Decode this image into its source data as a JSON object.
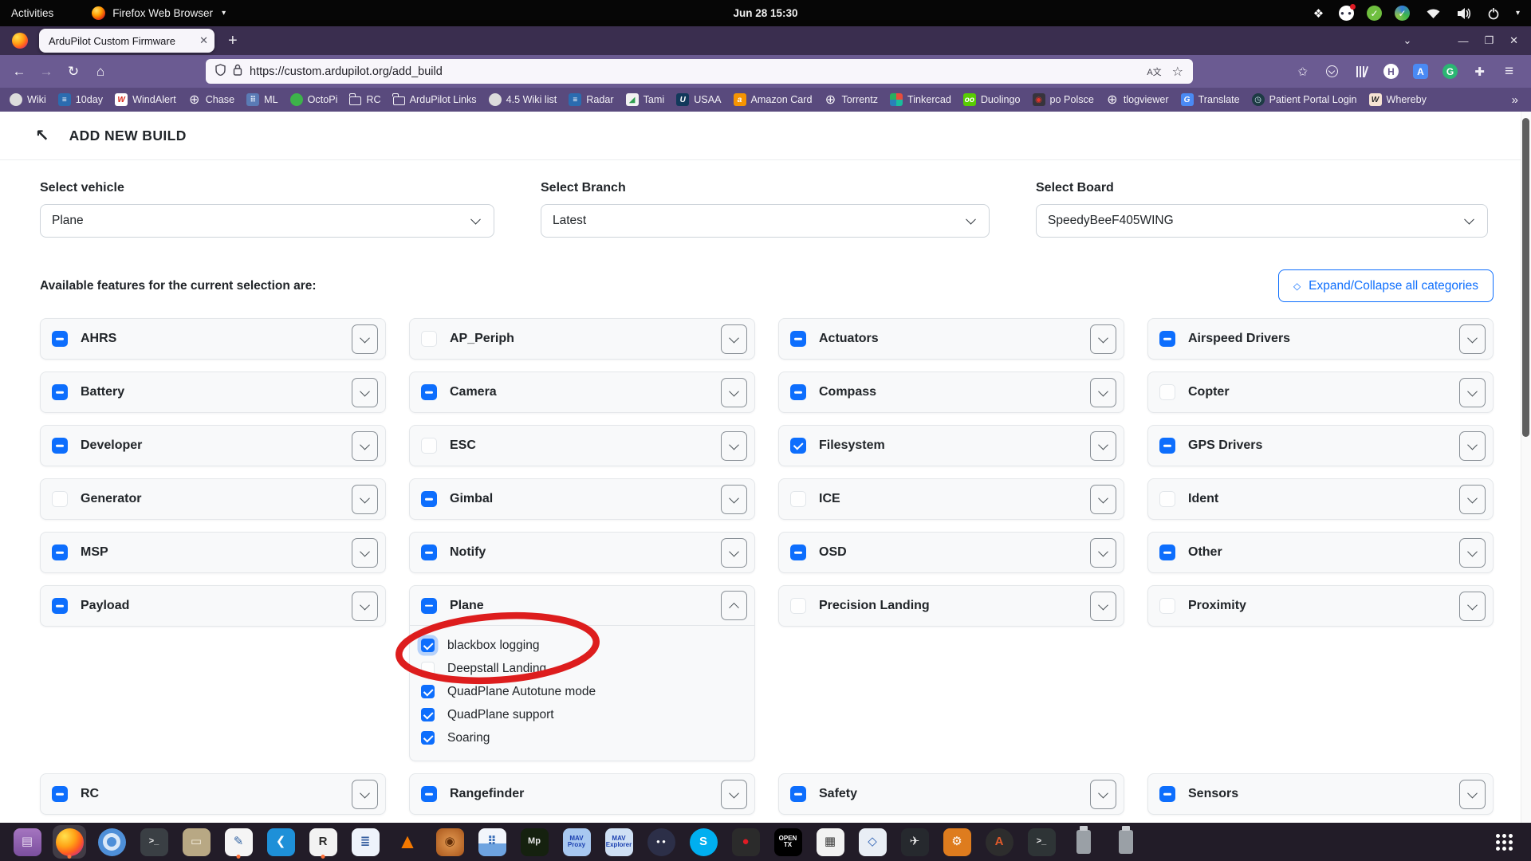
{
  "system_bar": {
    "activities_label": "Activities",
    "app_menu_label": "Firefox Web Browser",
    "app_menu_caret": "▾",
    "clock": "Jun 28 15:30",
    "tray": [
      {
        "name": "dropbox-icon",
        "glyph": "❖",
        "bg": "transparent",
        "fg": "#ffffff"
      },
      {
        "name": "discord-icon",
        "glyph": "● ●",
        "bg": "#ffffff",
        "fg": "#2b2d42",
        "notification": true
      },
      {
        "name": "todo-check-icon",
        "glyph": "✓",
        "bg": "#6fbf3f",
        "fg": "#ffffff"
      },
      {
        "name": "sync-check-icon",
        "glyph": "✓",
        "bg": "",
        "fg": "#ffffff"
      }
    ]
  },
  "browser": {
    "tab_title": "ArduPilot Custom Firmware",
    "tab_close_glyph": "✕",
    "new_tab_glyph": "+",
    "window_controls": [
      {
        "name": "list-tabs-chevron",
        "glyph": "⌄"
      },
      {
        "name": "minimize-button",
        "glyph": "—"
      },
      {
        "name": "restore-button",
        "glyph": "❐"
      },
      {
        "name": "close-button",
        "glyph": "✕"
      }
    ],
    "nav": {
      "back": "←",
      "forward": "→",
      "reload": "↻",
      "home": "⌂"
    },
    "url": "https://custom.ardupilot.org/add_build",
    "url_translate_glyph": "A文",
    "url_star_glyph": "☆",
    "toolbar_icons": [
      {
        "name": "account-star-icon",
        "glyph": "✩"
      },
      {
        "name": "pocket-icon",
        "glyph": ""
      },
      {
        "name": "library-icon",
        "glyph": ""
      },
      {
        "name": "h-extension-icon",
        "glyph": "H"
      },
      {
        "name": "translate-extension-icon",
        "glyph": "A"
      },
      {
        "name": "grammarly-icon",
        "glyph": "G"
      },
      {
        "name": "extensions-puzzle-icon",
        "glyph": "✚"
      },
      {
        "name": "menu-icon",
        "glyph": "≡"
      }
    ],
    "bookmarks": [
      {
        "label": "Wiki",
        "icon": "github-icon",
        "shape": "circle",
        "bg": "#dcdcdc",
        "fg": "#24292e",
        "glyph": ""
      },
      {
        "label": "10day",
        "icon": "weather-channel-icon",
        "shape": "",
        "bg": "#2b6cb0",
        "fg": "#fff",
        "glyph": "≡"
      },
      {
        "label": "WindAlert",
        "icon": "windalert-icon",
        "shape": "",
        "bg": "#fff",
        "fg": "#d6281a",
        "glyph": "W"
      },
      {
        "label": "Chase",
        "icon": "globe-icon",
        "shape": "globe",
        "bg": "",
        "fg": "#f4f2f7",
        "glyph": "⊕"
      },
      {
        "label": "ML",
        "icon": "ml-icon",
        "shape": "",
        "bg": "#5a7bb5",
        "fg": "#dce6f5",
        "glyph": "⠿"
      },
      {
        "label": "OctoPi",
        "icon": "octopi-icon",
        "shape": "circle",
        "bg": "#3db34a",
        "fg": "#fff",
        "glyph": ""
      },
      {
        "label": "RC",
        "icon": "folder-icon",
        "shape": "folder",
        "bg": "",
        "fg": "",
        "glyph": ""
      },
      {
        "label": "ArduPilot Links",
        "icon": "folder-icon",
        "shape": "folder",
        "bg": "",
        "fg": "",
        "glyph": ""
      },
      {
        "label": "4.5 Wiki list",
        "icon": "github-icon",
        "shape": "circle",
        "bg": "#dcdcdc",
        "fg": "#24292e",
        "glyph": ""
      },
      {
        "label": "Radar",
        "icon": "weather-channel-icon",
        "shape": "",
        "bg": "#2b6cb0",
        "fg": "#fff",
        "glyph": "≡"
      },
      {
        "label": "Tami",
        "icon": "chart-icon",
        "shape": "",
        "bg": "#f2f2f2",
        "fg": "#2e9e4f",
        "glyph": "◢"
      },
      {
        "label": "USAA",
        "icon": "usaa-icon",
        "shape": "",
        "bg": "#12395b",
        "fg": "#fff",
        "glyph": "U"
      },
      {
        "label": "Amazon  Card",
        "icon": "amazon-icon",
        "shape": "",
        "bg": "#f59402",
        "fg": "#fff",
        "glyph": "a"
      },
      {
        "label": "Torrentz",
        "icon": "globe-icon",
        "shape": "globe",
        "bg": "",
        "fg": "#f4f2f7",
        "glyph": "⊕"
      },
      {
        "label": "Tinkercad",
        "icon": "tinkercad-icon",
        "shape": "",
        "bg": "conic-gradient(#e74c3c 0 25%, #1abc9c 0 50%, #2980b9 0 75%, #27ae60 0)",
        "fg": "#fff",
        "glyph": ""
      },
      {
        "label": "Duolingo",
        "icon": "duolingo-icon",
        "shape": "",
        "bg": "#58cc02",
        "fg": "#fff",
        "glyph": "oo"
      },
      {
        "label": "po Polsce",
        "icon": "map-pin-icon",
        "shape": "",
        "bg": "#37343d",
        "fg": "#e0342b",
        "glyph": "◉"
      },
      {
        "label": "tlogviewer",
        "icon": "globe-icon",
        "shape": "globe",
        "bg": "",
        "fg": "#f4f2f7",
        "glyph": "⊕"
      },
      {
        "label": "Translate",
        "icon": "translate-icon",
        "shape": "",
        "bg": "#4a8af4",
        "fg": "#fff",
        "glyph": "G"
      },
      {
        "label": "Patient Portal Login",
        "icon": "portal-clock-icon",
        "shape": "circle",
        "bg": "#1d3b44",
        "fg": "#cfe7ee",
        "glyph": "◷"
      },
      {
        "label": "Whereby",
        "icon": "whereby-icon",
        "shape": "",
        "bg": "#f6e3d3",
        "fg": "#2b2b2b",
        "glyph": "W"
      }
    ],
    "bookmarks_overflow_glyph": "»"
  },
  "page": {
    "header_title": "ADD NEW BUILD",
    "back_arrow_glyph": "↖",
    "selectors": [
      {
        "label": "Select vehicle",
        "value": "Plane"
      },
      {
        "label": "Select Branch",
        "value": "Latest"
      },
      {
        "label": "Select Board",
        "value": "SpeedyBeeF405WING"
      }
    ],
    "features_heading": "Available features for the current selection are:",
    "expand_button_label": "Expand/Collapse all categories",
    "expand_button_glyph": "◇",
    "categories": [
      {
        "name": "AHRS",
        "state": "indeterminate"
      },
      {
        "name": "AP_Periph",
        "state": "unchecked"
      },
      {
        "name": "Actuators",
        "state": "indeterminate"
      },
      {
        "name": "Airspeed Drivers",
        "state": "indeterminate"
      },
      {
        "name": "Battery",
        "state": "indeterminate"
      },
      {
        "name": "Camera",
        "state": "indeterminate"
      },
      {
        "name": "Compass",
        "state": "indeterminate"
      },
      {
        "name": "Copter",
        "state": "unchecked"
      },
      {
        "name": "Developer",
        "state": "indeterminate"
      },
      {
        "name": "ESC",
        "state": "unchecked"
      },
      {
        "name": "Filesystem",
        "state": "checked"
      },
      {
        "name": "GPS Drivers",
        "state": "indeterminate"
      },
      {
        "name": "Generator",
        "state": "unchecked"
      },
      {
        "name": "Gimbal",
        "state": "indeterminate"
      },
      {
        "name": "ICE",
        "state": "unchecked"
      },
      {
        "name": "Ident",
        "state": "unchecked"
      },
      {
        "name": "MSP",
        "state": "indeterminate"
      },
      {
        "name": "Notify",
        "state": "indeterminate"
      },
      {
        "name": "OSD",
        "state": "indeterminate"
      },
      {
        "name": "Other",
        "state": "indeterminate"
      },
      {
        "name": "Payload",
        "state": "indeterminate"
      },
      {
        "name": "Plane",
        "state": "indeterminate",
        "expanded": true,
        "children": [
          {
            "label": "blackbox logging",
            "state": "checked",
            "focused": true
          },
          {
            "label": "Deepstall Landing",
            "state": "unchecked"
          },
          {
            "label": "QuadPlane Autotune mode",
            "state": "checked"
          },
          {
            "label": "QuadPlane support",
            "state": "checked"
          },
          {
            "label": "Soaring",
            "state": "checked"
          }
        ]
      },
      {
        "name": "Precision Landing",
        "state": "unchecked"
      },
      {
        "name": "Proximity",
        "state": "unchecked"
      },
      {
        "name": "RC",
        "state": "indeterminate"
      },
      {
        "name": "Rangefinder",
        "state": "indeterminate"
      },
      {
        "name": "Safety",
        "state": "indeterminate"
      },
      {
        "name": "Sensors",
        "state": "indeterminate"
      }
    ],
    "annotation": {
      "type": "red-ellipse",
      "target": "blackbox logging",
      "color": "#dd1d1d"
    }
  },
  "dock": {
    "items": [
      {
        "app": "purple-files",
        "icon": "purple-app-icon",
        "bg": "linear-gradient(180deg,#a575c0,#7b4f9e)",
        "fg": "#e7d9f0",
        "glyph": "▤"
      },
      {
        "app": "firefox",
        "icon": "firefox-icon",
        "shape": "firefox-shape",
        "glyph": "",
        "active": true,
        "running": true
      },
      {
        "app": "chromium",
        "icon": "chromium-icon",
        "shape": "circle ring",
        "bg": "#4e8fd8",
        "glyph": ""
      },
      {
        "app": "terminal",
        "icon": "terminal-icon",
        "bg": "#3a3f44",
        "fg": "#e6e6e6",
        "glyph": ">_",
        "size": "mid"
      },
      {
        "app": "files",
        "icon": "folder-icon",
        "bg": "#b8a884",
        "fg": "#f4eedd",
        "glyph": "▭"
      },
      {
        "app": "text-editor",
        "icon": "text-editor-icon",
        "bg": "#f5f5f5",
        "fg": "#3465a4",
        "glyph": "✎",
        "running": true
      },
      {
        "app": "vscode",
        "icon": "vscode-icon",
        "bg": "#1e90d8",
        "fg": "#fff",
        "glyph": "❮"
      },
      {
        "app": "r-notepad",
        "icon": "r-app-icon",
        "bg": "#f2f2f2",
        "fg": "#2b2b2b",
        "glyph": "R",
        "running": true
      },
      {
        "app": "libreoffice-writer",
        "icon": "writer-icon",
        "bg": "#eef3fb",
        "fg": "#355fa0",
        "glyph": "≣"
      },
      {
        "app": "vlc",
        "icon": "vlc-cone-icon",
        "shape": "cone",
        "fg": "#f57900",
        "glyph": "▲"
      },
      {
        "app": "spiral-app",
        "icon": "spiral-app-icon",
        "bg": "radial-gradient(circle,#e39a52,#a9561b)",
        "fg": "#5f2c08",
        "glyph": "◉"
      },
      {
        "app": "snap-store",
        "icon": "app-store-bag-icon",
        "bg": "linear-gradient(180deg,#f2f5fb 55%,#6ea3e0 55%)",
        "fg": "#3a6fb8",
        "glyph": "⠿"
      },
      {
        "app": "mission-planner",
        "icon": "mission-planner-icon",
        "bg": "#15210f",
        "fg": "#e8e8e8",
        "glyph": "Mp",
        "size": "mid"
      },
      {
        "app": "mavproxy",
        "icon": "mavproxy-icon",
        "bg": "#a8c8f0",
        "fg": "#1a3fb0",
        "glyph": "MAV\nProxy",
        "size": "tiny"
      },
      {
        "app": "mavexplorer",
        "icon": "mavexplorer-icon",
        "bg": "#cfe0f4",
        "fg": "#1a3fb0",
        "glyph": "MAV\nExplorer",
        "size": "tiny"
      },
      {
        "app": "discord",
        "icon": "discord-icon",
        "shape": "circle",
        "bg": "#2c2f48",
        "fg": "#fff",
        "glyph": "● ●",
        "size": "tiny"
      },
      {
        "app": "skype",
        "icon": "skype-icon",
        "shape": "circle",
        "bg": "#00aff0",
        "fg": "#fff",
        "glyph": "S"
      },
      {
        "app": "screen-recorder",
        "icon": "record-dot-icon",
        "bg": "#2b2b2b",
        "fg": "#e01b24",
        "glyph": "●"
      },
      {
        "app": "opentx",
        "icon": "opentx-icon",
        "bg": "#000",
        "fg": "#fff",
        "glyph": "OPEN\nTX",
        "size": "tiny"
      },
      {
        "app": "printer-app",
        "icon": "printer-icon",
        "bg": "#f2f2f2",
        "fg": "#3c3c3c",
        "glyph": "▦"
      },
      {
        "app": "virtualbox",
        "icon": "virtualbox-icon",
        "bg": "#e9eef5",
        "fg": "#2a5fb4",
        "glyph": "◇"
      },
      {
        "app": "flight-app",
        "icon": "airplane-app-icon",
        "bg": "#26292e",
        "fg": "#e8e8e8",
        "glyph": "✈"
      },
      {
        "app": "orange-tool",
        "icon": "orange-app-icon",
        "bg": "#de7c1e",
        "fg": "#fff",
        "glyph": "⚙"
      },
      {
        "app": "arduino",
        "icon": "arduino-icon",
        "shape": "circle",
        "bg": "#2d2d2d",
        "fg": "#e05a2b",
        "glyph": "A"
      },
      {
        "app": "terminal-2",
        "icon": "terminal-icon",
        "bg": "#2e3436",
        "fg": "#e6e6e6",
        "glyph": ">_",
        "size": "mid"
      },
      {
        "app": "usb-drive-1",
        "icon": "usb-drive-icon",
        "shape": "usb",
        "bg": "#9aa0a6",
        "glyph": ""
      },
      {
        "app": "usb-drive-2",
        "icon": "usb-drive-icon",
        "shape": "usb",
        "bg": "#9aa0a6",
        "glyph": ""
      },
      {
        "app": "show-applications",
        "icon": "app-grid-icon",
        "shape": "dots",
        "glyph": "",
        "push_right": true
      }
    ]
  }
}
